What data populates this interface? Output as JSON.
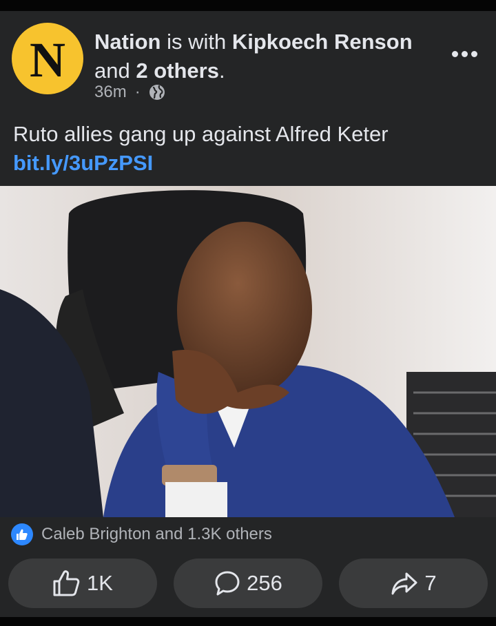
{
  "post": {
    "page_name": "Nation",
    "with_text": "is with",
    "tagged_person": "Kipkoech Renson",
    "and_text": "and",
    "others_text": "2 others",
    "period": ".",
    "avatar_letter": "N",
    "time_ago": "36m",
    "separator": "·",
    "privacy_icon": "globe-icon",
    "more_icon": "more-options-icon",
    "caption_text": "Ruto allies gang up against Alfred Keter ",
    "caption_link": "bit.ly/3uPzPSI",
    "reactions_text": "Caleb Brighton and 1.3K others",
    "reaction_icon": "like-reaction-icon"
  },
  "actions": {
    "like_count": "1K",
    "comment_count": "256",
    "share_count": "7"
  },
  "colors": {
    "background": "#242526",
    "link": "#4599ff",
    "avatar_bg": "#f7c32e",
    "button_bg": "#3a3b3c",
    "like_badge": "#2d88ff"
  }
}
